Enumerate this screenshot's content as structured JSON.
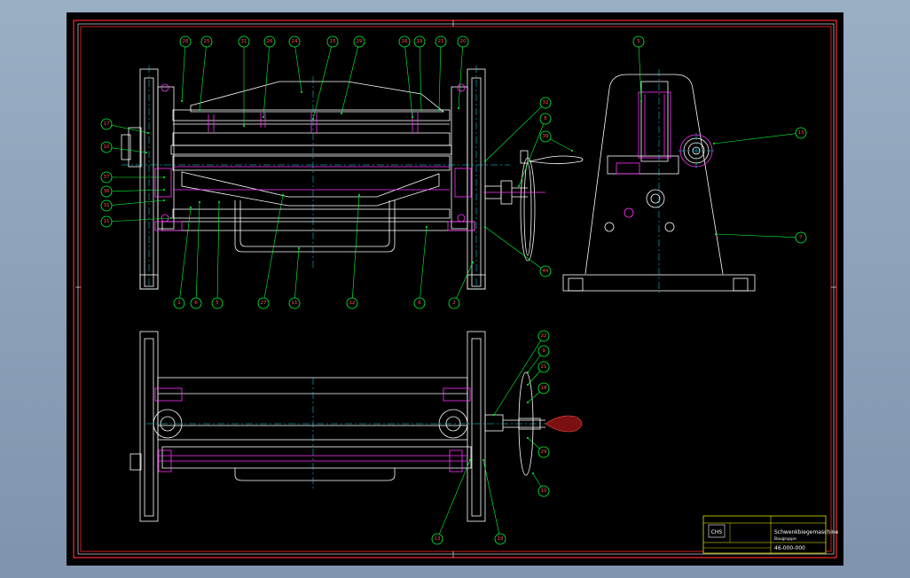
{
  "title_block": {
    "name": "Schwenkbiegemaschine",
    "subtitle": "Baugruppe",
    "drawing_number": "46-000-000",
    "logo_text": "CHS"
  },
  "balloons": {
    "front_view_top": [
      "28",
      "25",
      "31",
      "26",
      "24",
      "15",
      "29",
      "16",
      "19",
      "21",
      "20"
    ],
    "front_view_left": [
      "17",
      "10",
      "37",
      "36",
      "31",
      "11"
    ],
    "front_view_right": [
      "32",
      "8",
      "39",
      "44"
    ],
    "front_view_bottom": [
      "1",
      "6",
      "5",
      "27",
      "11",
      "12",
      "6",
      "2"
    ],
    "side_view": [
      "5",
      "13",
      "7"
    ],
    "top_view_right": [
      "22",
      "9",
      "21",
      "18",
      "29",
      "10"
    ],
    "top_view_bottom": [
      "13",
      "19"
    ]
  },
  "colors": {
    "sheet_background": "#000000",
    "frame": "#ff2a2a",
    "geometry": "#ffffff",
    "hidden_parts": "#ff33ff",
    "leaders": "#00ff33",
    "centerlines": "#00e5ff",
    "dimensions": "#ffff00"
  }
}
